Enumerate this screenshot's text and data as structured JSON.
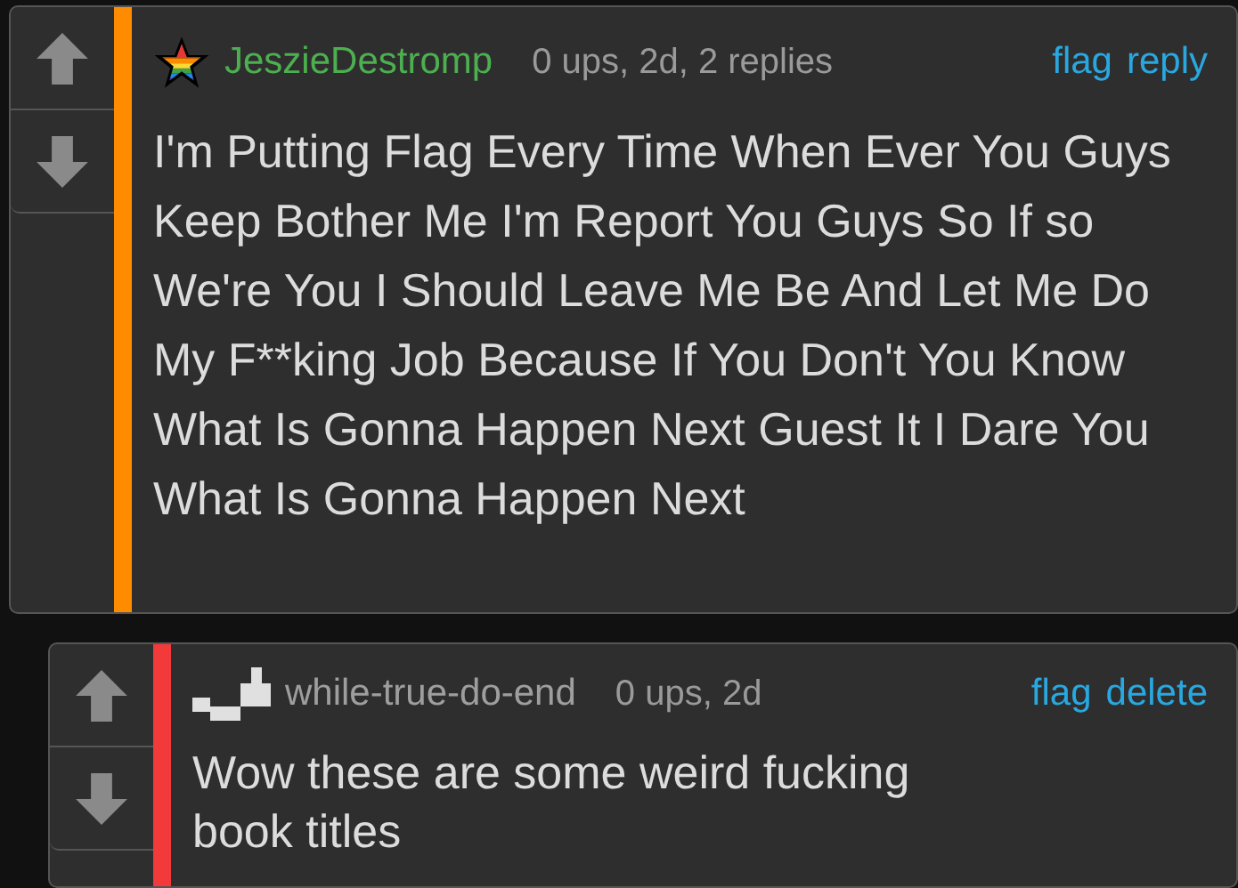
{
  "comments": [
    {
      "author": {
        "name": "JeszieDestromp",
        "kind": "star",
        "color": "#4caf50"
      },
      "color": "#ff8c00",
      "meta": "0 ups, 2d, 2 replies",
      "actions": [
        "flag",
        "reply"
      ],
      "text": "I'm Putting Flag Every Time When Ever You Guys Keep Bother Me I'm Report You Guys So If so We're You I Should Leave Me Be And Let Me Do My F**king Job Because If You Don't You Know What Is Gonna Happen Next Guest It I Dare You What Is Gonna Happen Next",
      "reply": false
    },
    {
      "author": {
        "name": "while-true-do-end",
        "kind": "blocks",
        "color": "#9e9e9e"
      },
      "color": "#f23a3a",
      "meta": "0 ups, 2d",
      "actions": [
        "flag",
        "delete"
      ],
      "text": "Wow these are some weird fucking book titles",
      "reply": true
    }
  ]
}
